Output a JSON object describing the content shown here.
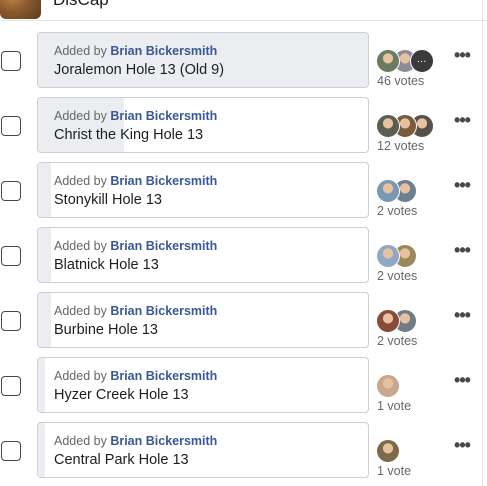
{
  "group": {
    "name": "DisCap"
  },
  "poll": {
    "added_prefix": "Added by",
    "options": [
      {
        "author": "Brian Bickersmith",
        "name": "Joralemon Hole 13 (Old 9)",
        "votes": "46 votes",
        "share": 1.0,
        "voter_colors": [
          "#6b7b5e",
          "#8d8b98",
          "#3f4448"
        ],
        "has_more": true
      },
      {
        "author": "Brian Bickersmith",
        "name": "Christ the King Hole 13",
        "votes": "12 votes",
        "share": 0.26,
        "voter_colors": [
          "#5c5e54",
          "#7b5b3e",
          "#55514a"
        ],
        "has_more": false
      },
      {
        "author": "Brian Bickersmith",
        "name": "Stonykill Hole 13",
        "votes": "2 votes",
        "share": 0.04,
        "voter_colors": [
          "#7a98b4",
          "#6e7f92"
        ],
        "has_more": false
      },
      {
        "author": "Brian Bickersmith",
        "name": "Blatnick Hole 13",
        "votes": "2 votes",
        "share": 0.04,
        "voter_colors": [
          "#8fa8c4",
          "#9a8a5a"
        ],
        "has_more": false
      },
      {
        "author": "Brian Bickersmith",
        "name": "Burbine Hole 13",
        "votes": "2 votes",
        "share": 0.04,
        "voter_colors": [
          "#8a4a3a",
          "#6f7d86"
        ],
        "has_more": false
      },
      {
        "author": "Brian Bickersmith",
        "name": "Hyzer Creek Hole 13",
        "votes": "1 vote",
        "share": 0.02,
        "voter_colors": [
          "#c9a78e"
        ],
        "has_more": false
      },
      {
        "author": "Brian Bickersmith",
        "name": "Central Park Hole 13",
        "votes": "1 vote",
        "share": 0.02,
        "voter_colors": [
          "#7d6a4a"
        ],
        "has_more": false
      }
    ]
  },
  "icons": {
    "checkbox": "checkbox-icon",
    "more": "more-options-icon"
  }
}
